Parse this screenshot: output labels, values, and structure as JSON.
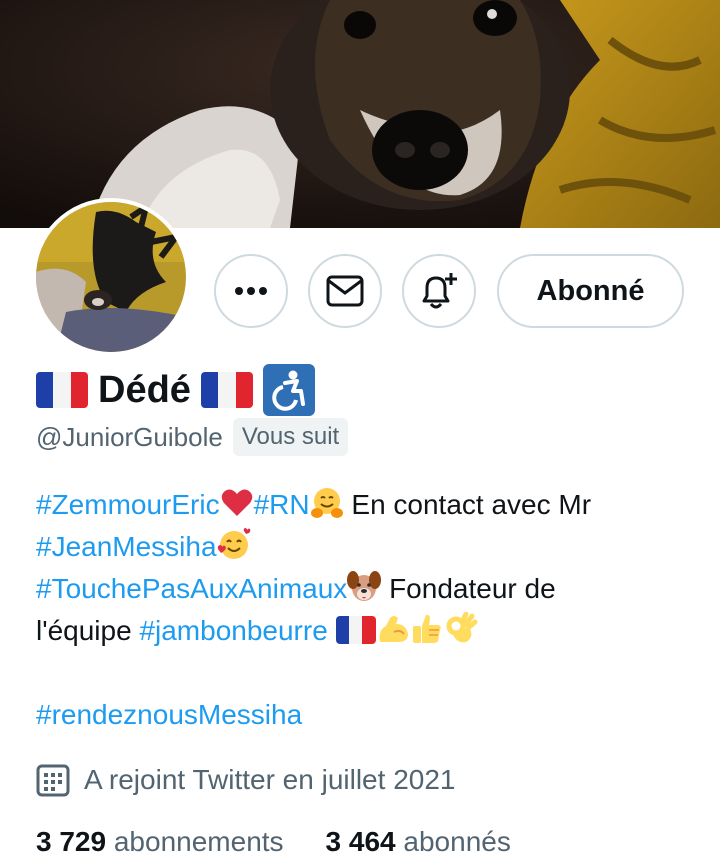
{
  "profile": {
    "name": "Dédé",
    "handle": "@JuniorGuibole",
    "follows_you_label": "Vous suit",
    "follow_button_label": "Abonné"
  },
  "bio": {
    "line1_tag1": "#ZemmourEric",
    "line1_tag2": "#RN",
    "line1_text": " En contact avec Mr",
    "line2_tag": "#JeanMessiha",
    "line3_tag": "#TouchePasAuxAnimaux",
    "line3_text": " Fondateur de",
    "line4_text": "l'équipe ",
    "line4_tag": "#jambonbeurre",
    "line5_tag": "#rendeznousMessiha"
  },
  "joined_text": "A rejoint Twitter en juillet 2021",
  "stats": {
    "following_count": "3 729",
    "following_label": "abonnements",
    "followers_count": "3 464",
    "followers_label": "abonnés"
  },
  "icons": [
    "more-icon",
    "mail-icon",
    "bell-plus-icon",
    "calendar-icon",
    "wheelchair-icon",
    "french-flag-icon"
  ],
  "colors": {
    "link": "#1d9bf0",
    "secondary_text": "#536471",
    "border": "#cfd9de",
    "badge_bg": "#eff3f4"
  }
}
